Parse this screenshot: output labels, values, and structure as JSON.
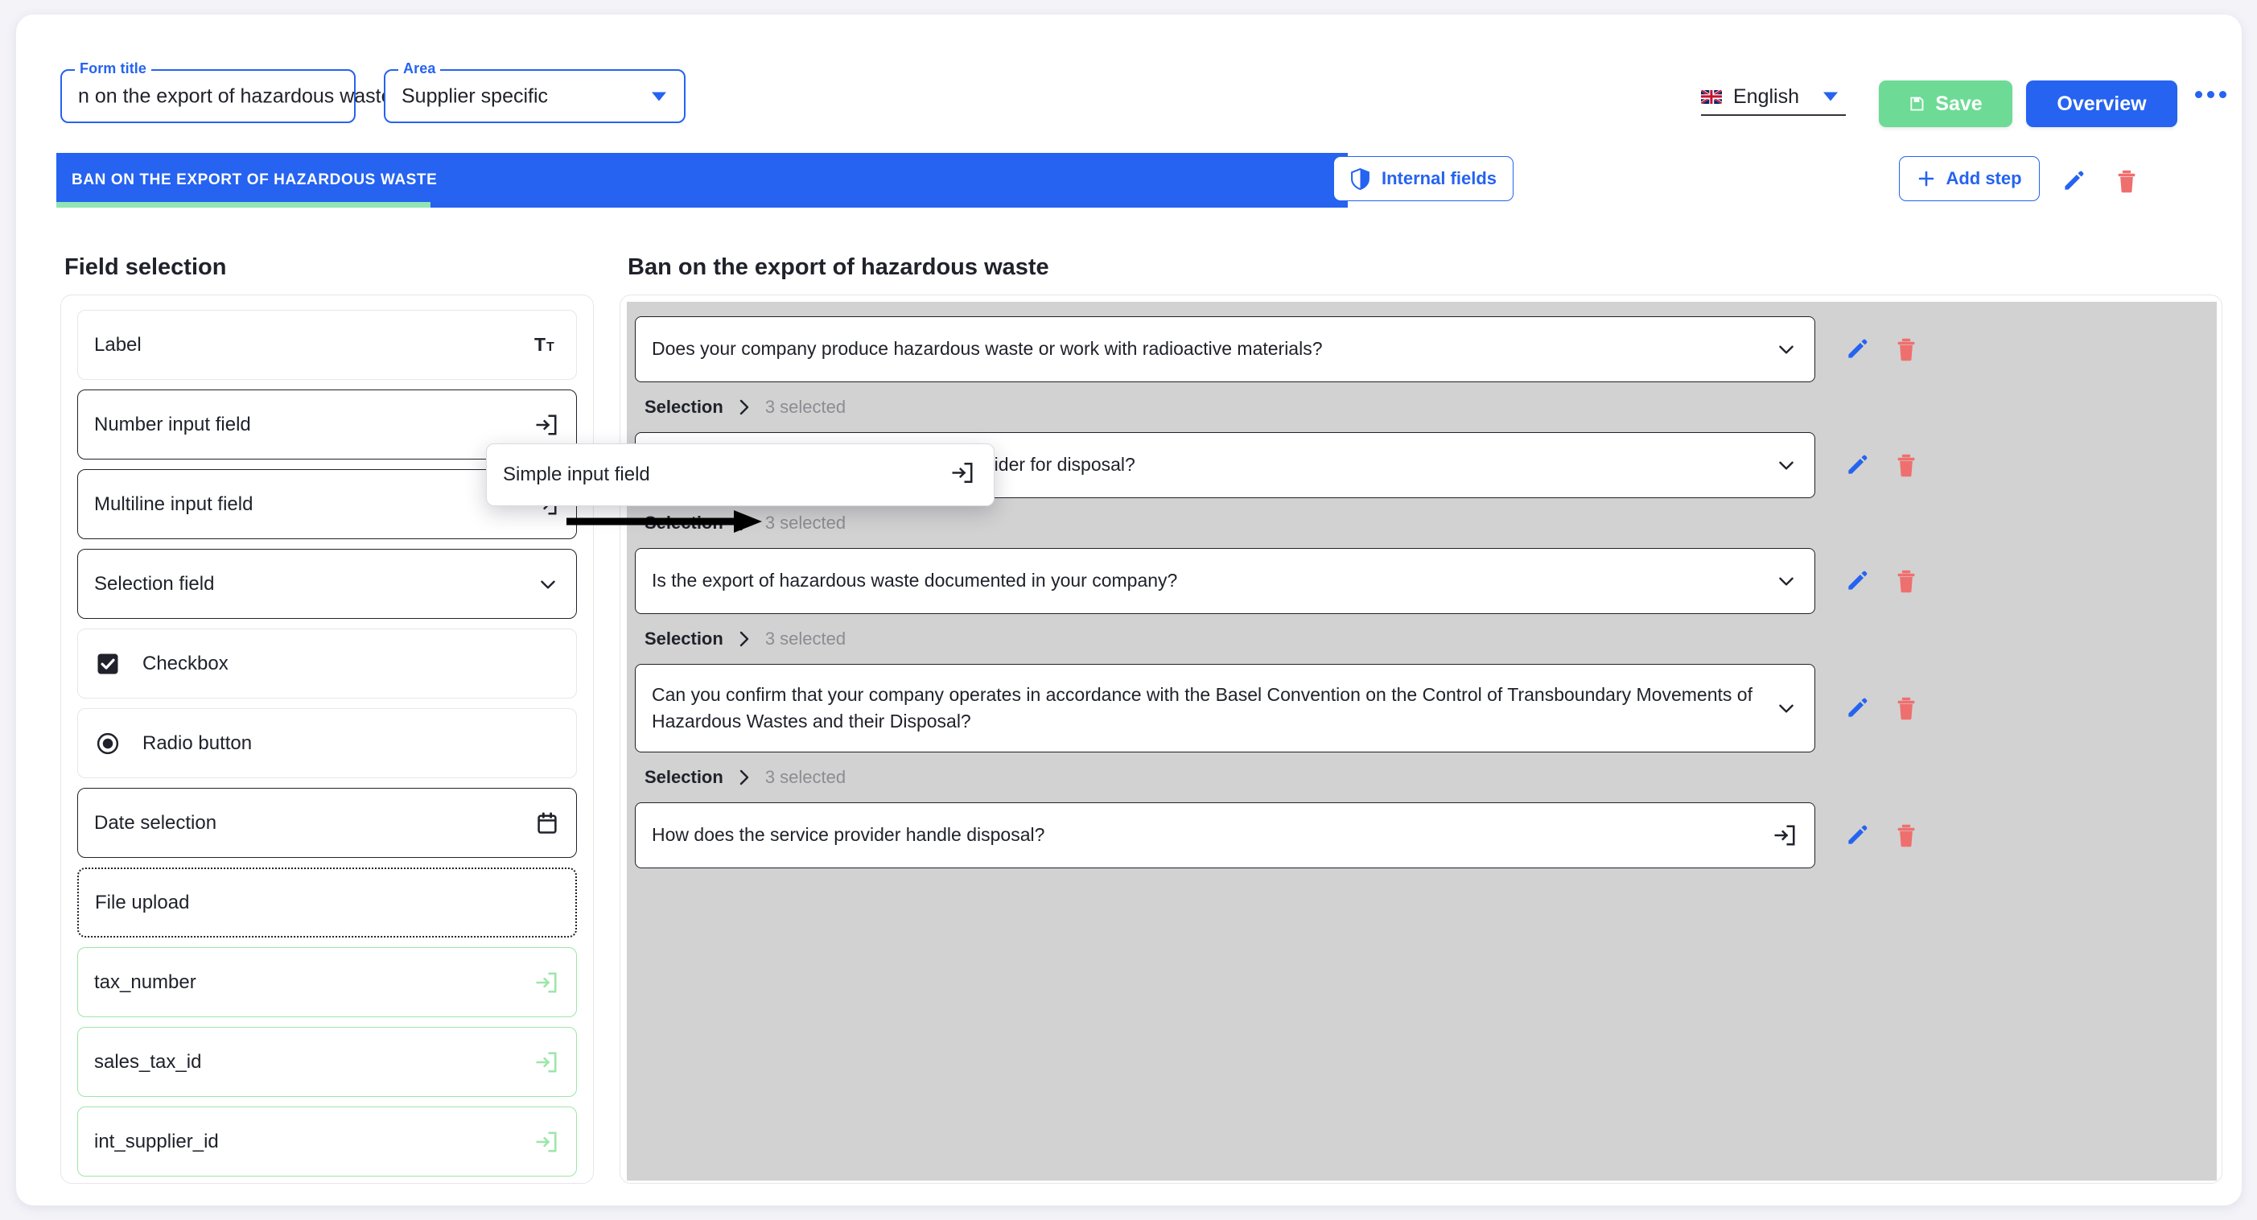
{
  "header": {
    "form_title_legend": "Form title",
    "form_title_value": "n on the export of hazardous waste",
    "area_legend": "Area",
    "area_value": "Supplier specific",
    "language": "English",
    "language_flag_icon": "uk-flag-icon",
    "save_label": "Save",
    "overview_label": "Overview",
    "more_menu_icon": "ellipsis-icon"
  },
  "stepbar": {
    "step_title": "BAN ON THE EXPORT OF HAZARDOUS WASTE",
    "internal_fields_label": "Internal fields",
    "internal_fields_icon": "shield-icon",
    "add_step_label": "Add step",
    "add_step_icon": "plus-icon",
    "edit_icon": "pencil-icon",
    "delete_icon": "trash-icon",
    "progress_percent": 29
  },
  "sidebar": {
    "title": "Field selection",
    "items": [
      {
        "label": "Label",
        "icon": "typography-icon",
        "style": "light",
        "icon_side": "right"
      },
      {
        "label": "Number input field",
        "icon": "input-field-icon",
        "style": "strong",
        "icon_side": "right"
      },
      {
        "label": "Multiline input field",
        "icon": "input-field-icon",
        "style": "strong",
        "icon_side": "right"
      },
      {
        "label": "Selection field",
        "icon": "chevron-down-icon",
        "style": "strong",
        "icon_side": "right"
      },
      {
        "label": "Checkbox",
        "icon": "checkbox-checked-icon",
        "style": "light",
        "icon_side": "left"
      },
      {
        "label": "Radio button",
        "icon": "radio-button-icon",
        "style": "light",
        "icon_side": "left"
      },
      {
        "label": "Date selection",
        "icon": "calendar-icon",
        "style": "strong",
        "icon_side": "right"
      },
      {
        "label": "File upload",
        "icon": "none",
        "style": "dashed",
        "icon_side": "right"
      },
      {
        "label": "tax_number",
        "icon": "input-field-icon",
        "style": "green",
        "icon_side": "right"
      },
      {
        "label": "sales_tax_id",
        "icon": "input-field-icon",
        "style": "green",
        "icon_side": "right"
      },
      {
        "label": "int_supplier_id",
        "icon": "input-field-icon",
        "style": "green",
        "icon_side": "right"
      }
    ]
  },
  "drag_ghost": {
    "label": "Simple input field",
    "icon": "input-field-icon"
  },
  "panel": {
    "title": "Ban on the export of hazardous waste",
    "selection_label": "Selection",
    "selection_chevron_icon": "chevron-right-icon",
    "selection_count": "3 selected",
    "edit_icon": "pencil-icon",
    "delete_icon": "trash-icon",
    "questions": [
      {
        "text": "Does your company produce hazardous waste or work with radioactive materials?",
        "icon": "chevron-down-icon",
        "has_selection_row": true,
        "tall": false
      },
      {
        "text": "Do you work with an external service provider for disposal?",
        "icon": "chevron-down-icon",
        "has_selection_row": true,
        "tall": false
      },
      {
        "text": "Is the export of hazardous waste documented in your company?",
        "icon": "chevron-down-icon",
        "has_selection_row": true,
        "tall": false
      },
      {
        "text": "Can you confirm that your company operates in accordance with the Basel Convention on the Control of Transboundary Movements of Hazardous Wastes and their Disposal?",
        "icon": "chevron-down-icon",
        "has_selection_row": true,
        "tall": true
      },
      {
        "text": "How does the service provider handle disposal?",
        "icon": "input-field-icon",
        "has_selection_row": false,
        "tall": false
      }
    ]
  },
  "colors": {
    "accent_blue": "#2563f0",
    "save_green": "#6ddb95",
    "progress_green": "#8fe5b4",
    "delete_red": "#ef6f6f",
    "panel_gray": "#d2d2d2",
    "page_bg": "#f3f3f8",
    "green_border": "#9ce6a9"
  }
}
